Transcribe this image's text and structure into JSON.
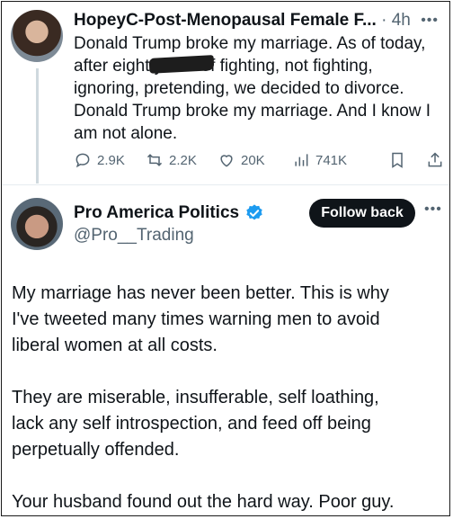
{
  "tweet1": {
    "author_name": "HopeyC-Post-Menopausal Female F...",
    "time": "4h",
    "more_icon": "more-horizontal-icon",
    "text": "Donald Trump broke my marriage. As of today,\nafter eight                years of fighting, not fighting,\nignoring, pretending, we decided to divorce.\nDonald Trump broke my marriage. And I know I\nam not alone.",
    "actions": {
      "replies": "2.9K",
      "reposts": "2.2K",
      "likes": "20K",
      "views": "741K"
    },
    "colors": {
      "text": "#0f1419",
      "muted": "#536471"
    }
  },
  "tweet2": {
    "author_name": "Pro America Politics",
    "verified_icon": "verified-badge-icon",
    "handle": "@Pro__Trading",
    "follow_label": "Follow back",
    "text": "My marriage has never been better. This is why\nI've tweeted many times warning men to avoid\nliberal women at all costs.\n\nThey are miserable, insufferable, self loathing,\nlack any self introspection, and feed off being\nperpetually offended.\n\nYour husband found out the hard way. Poor guy.",
    "colors": {
      "verified": "#1d9bf0",
      "button_bg": "#0f1419",
      "button_text": "#ffffff"
    }
  }
}
